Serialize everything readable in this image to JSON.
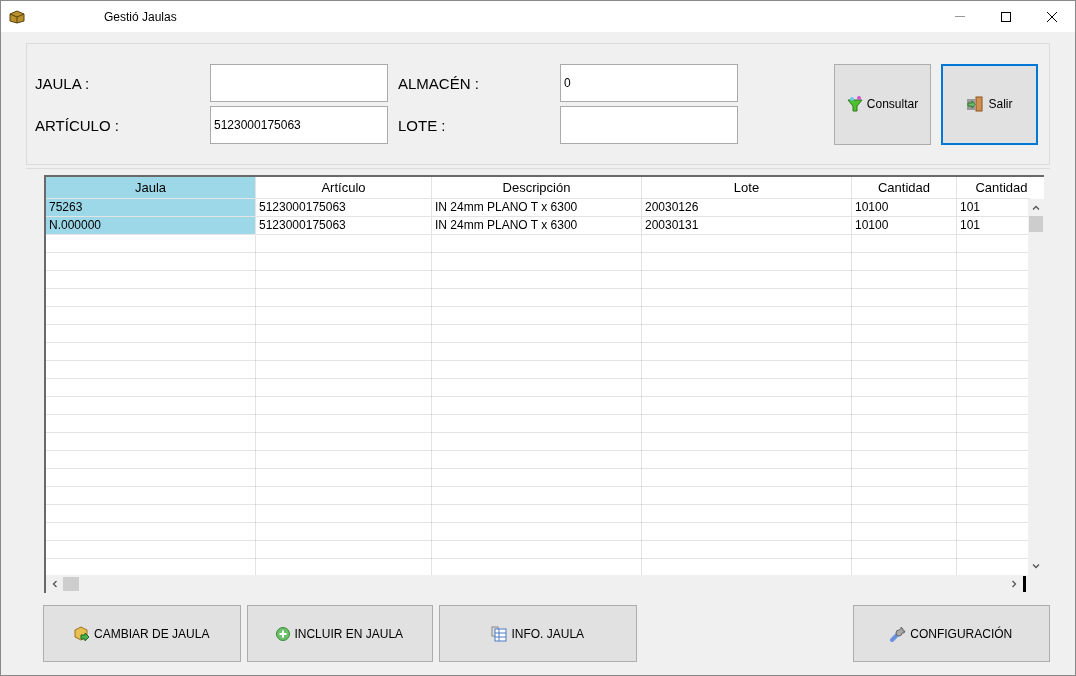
{
  "window": {
    "title": "Gestió Jaulas"
  },
  "filters": [
    {
      "label": "JAULA :"
    },
    {
      "label": "ALMACÉN :",
      "value": "0"
    },
    {
      "label": "ARTÍCULO :",
      "value": "5123000175063"
    },
    {
      "label": "LOTE :"
    }
  ],
  "actions": [
    {
      "label": "Consultar",
      "kind": "filter",
      "selected": false
    },
    {
      "label": "Salir",
      "kind": "exit",
      "selected": true
    }
  ],
  "table": {
    "columns": [
      {
        "label": "Jaula",
        "selected": true
      },
      {
        "label": "Artículo",
        "selected": false
      },
      {
        "label": "Descripción",
        "selected": false
      },
      {
        "label": "Lote",
        "selected": false
      },
      {
        "label": "Cantidad",
        "selected": false
      },
      {
        "label": "Cantidad",
        "selected": false
      }
    ],
    "rows": [
      [
        "75263",
        "5123000175063",
        "IN 24mm PLANO T x 6300",
        "20030126",
        "10100",
        "101"
      ],
      [
        "N.000000",
        "5123000175063",
        "IN 24mm PLANO T x 6300",
        "20030131",
        "10100",
        "101"
      ]
    ]
  },
  "bottom_buttons": [
    {
      "label": "CAMBIAR DE JAULA",
      "kind": "move"
    },
    {
      "label": "INCLUIR EN JAULA",
      "kind": "add"
    },
    {
      "label": "INFO. JAULA",
      "kind": "info"
    },
    {
      "label": "CONFIGURACIÓN",
      "kind": "config"
    }
  ]
}
